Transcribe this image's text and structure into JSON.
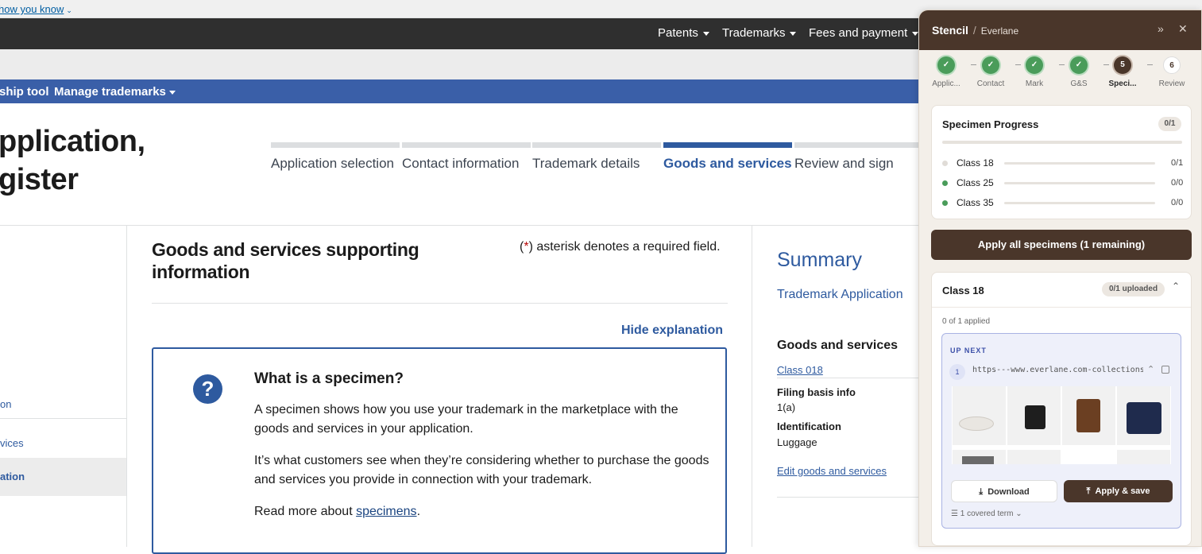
{
  "banner": {
    "link": "how you know"
  },
  "topnav": {
    "items": [
      "Patents",
      "Trademarks",
      "Fees and payment"
    ]
  },
  "subnav": {
    "items": [
      "ship tool",
      "Manage trademarks"
    ]
  },
  "page": {
    "title_line1": "pplication,",
    "title_line2": "gister"
  },
  "stepper": [
    {
      "label": "Application selection",
      "active": false
    },
    {
      "label": "Contact information",
      "active": false
    },
    {
      "label": "Trademark details",
      "active": false
    },
    {
      "label": "Goods and services",
      "active": true
    },
    {
      "label": "Review and sign",
      "active": false
    }
  ],
  "sidebar": {
    "items": [
      "on",
      "vices",
      "ation"
    ]
  },
  "main": {
    "heading": "Goods and services supporting information",
    "required_prefix": "(",
    "required_star": "*",
    "required_suffix": ") asterisk denotes a required field.",
    "hide_explanation": "Hide explanation",
    "specimen": {
      "title": "What is a specimen?",
      "p1": "A specimen shows how you use your trademark in the marketplace with the goods and services in your application.",
      "p2": "It’s what customers see when they’re considering whether to purchase the goods and services you provide in connection with your trademark.",
      "p3_prefix": "Read more about ",
      "p3_link": "specimens",
      "p3_suffix": "."
    }
  },
  "summary": {
    "title": "Summary",
    "app_link": "Trademark Application",
    "gs_heading": "Goods and services",
    "class_link": "Class 018",
    "filing_label": "Filing basis info",
    "filing_value": "1(a)",
    "ident_label": "Identification",
    "ident_value": "Luggage",
    "edit_link": "Edit goods and services"
  },
  "stencil": {
    "brand": "Stencil",
    "company": "Everlane",
    "steps": [
      {
        "label": "Applic...",
        "state": "done",
        "num": "1"
      },
      {
        "label": "Contact",
        "state": "done",
        "num": "2"
      },
      {
        "label": "Mark",
        "state": "done",
        "num": "3"
      },
      {
        "label": "G&S",
        "state": "done",
        "num": "4"
      },
      {
        "label": "Speci...",
        "state": "current",
        "num": "5"
      },
      {
        "label": "Review",
        "state": "todo",
        "num": "6"
      }
    ],
    "progress": {
      "title": "Specimen Progress",
      "badge": "0/1",
      "overall_fraction": 0,
      "classes": [
        {
          "label": "Class 18",
          "count": "0/1",
          "fraction": 0,
          "dot": "#e0dcd7"
        },
        {
          "label": "Class 25",
          "count": "0/0",
          "fraction": 0,
          "dot": "#4a9c5a"
        },
        {
          "label": "Class 35",
          "count": "0/0",
          "fraction": 0,
          "dot": "#4a9c5a"
        }
      ]
    },
    "apply_all": "Apply all specimens (1 remaining)",
    "class_card": {
      "title": "Class 18",
      "badge": "0/1 uploaded",
      "applied": "0 of 1 applied",
      "up_next_label": "UP NEXT",
      "item_number": "1",
      "url": "https---www.everlane.com-collections-bags",
      "download": "Download",
      "apply_save": "Apply & save",
      "covered": "1 covered term"
    }
  },
  "colors": {
    "accent": "#2e5a9f",
    "stencil_brown": "#4a362a",
    "done_green": "#4a9c5a"
  }
}
